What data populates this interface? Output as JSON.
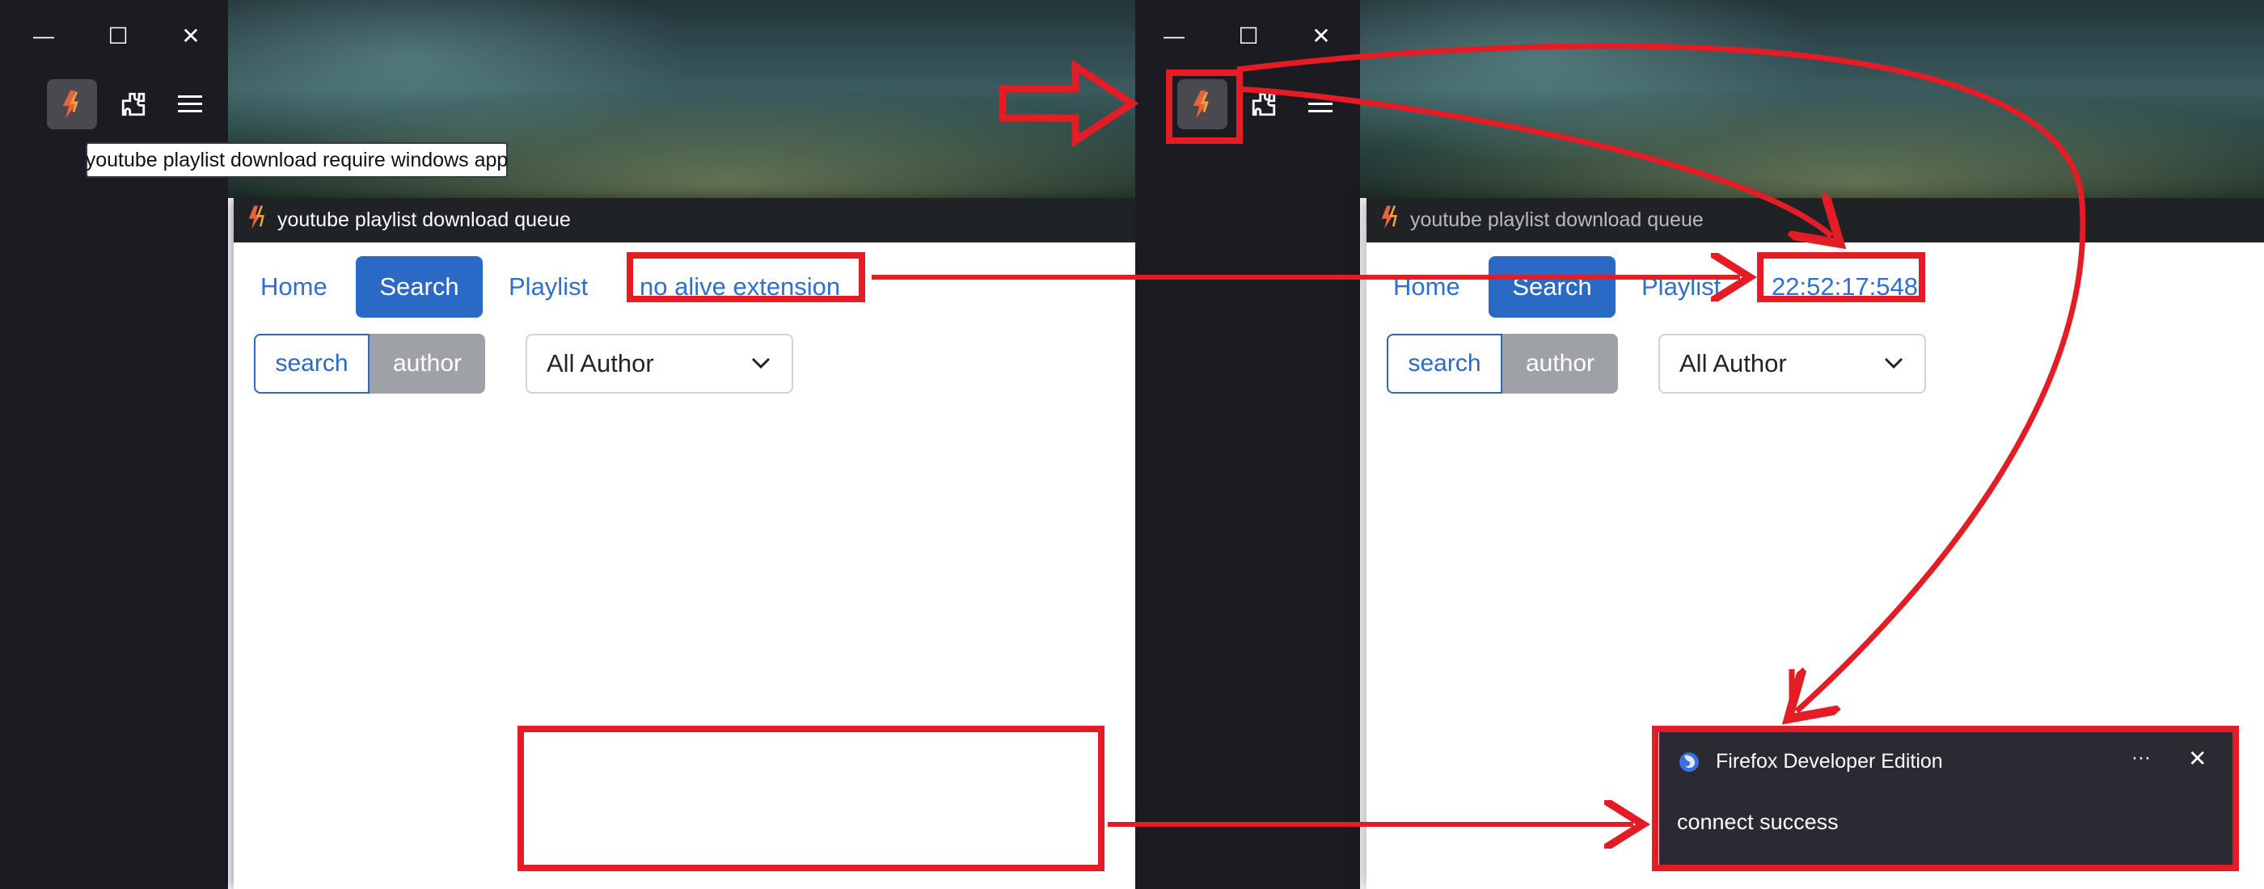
{
  "left": {
    "window_controls": {
      "minimize": "—",
      "maximize": "☐",
      "close": "✕"
    },
    "tooltip": "youtube playlist download require windows app",
    "popup": {
      "title": "youtube playlist download queue",
      "nav": {
        "home": "Home",
        "search": "Search",
        "playlist": "Playlist",
        "status": "no alive extension"
      },
      "filters": {
        "search": "search",
        "author": "author",
        "select": "All Author"
      }
    }
  },
  "right": {
    "window_controls": {
      "minimize": "—",
      "maximize": "☐",
      "close": "✕"
    },
    "popup": {
      "title": "youtube playlist download queue",
      "nav": {
        "home": "Home",
        "search": "Search",
        "playlist": "Playlist",
        "status": "22:52:17:548"
      },
      "filters": {
        "search": "search",
        "author": "author",
        "select": "All Author"
      }
    }
  },
  "notification": {
    "app": "Firefox Developer Edition",
    "more": "···",
    "close": "✕",
    "message": "connect success"
  },
  "colors": {
    "annotation_red": "#e31c25",
    "link_blue": "#2f6fd1",
    "primary_blue": "#2b69c6"
  }
}
